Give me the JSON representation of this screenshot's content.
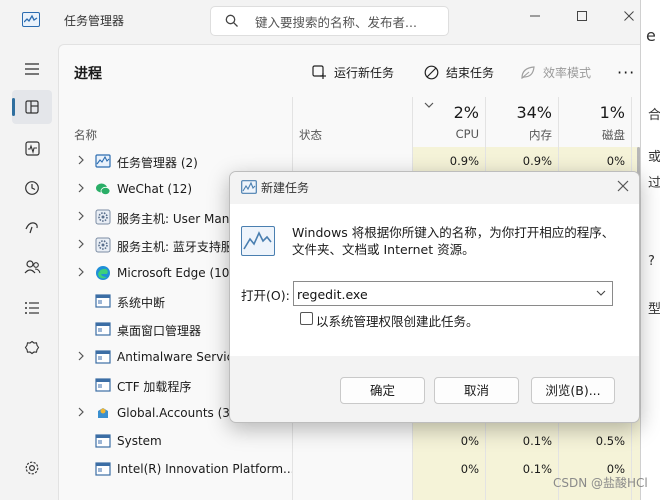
{
  "background_window": {
    "fragments": [
      "e",
      "合",
      "或",
      "过",
      "?",
      "型"
    ]
  },
  "window": {
    "title": "任务管理器",
    "search_placeholder": "键入要搜索的名称、发布者...",
    "controls": {
      "minimize_icon": "minimize-icon",
      "maximize_icon": "maximize-icon",
      "close_icon": "close-icon"
    }
  },
  "rail": {
    "items": [
      {
        "name": "menu-icon"
      },
      {
        "name": "processes-icon",
        "active": true
      },
      {
        "name": "performance-icon"
      },
      {
        "name": "app-history-icon"
      },
      {
        "name": "startup-apps-icon"
      },
      {
        "name": "users-icon"
      },
      {
        "name": "details-icon"
      },
      {
        "name": "services-icon"
      },
      {
        "name": "settings-icon"
      }
    ]
  },
  "page": {
    "title": "进程",
    "commands": {
      "new_task": "运行新任务",
      "end_task": "结束任务",
      "efficiency": "效率模式",
      "more": "···"
    }
  },
  "table": {
    "headers": {
      "name": "名称",
      "status": "状态",
      "cpu_pct": "2%",
      "cpu": "CPU",
      "mem_pct": "34%",
      "mem": "内存",
      "disk_pct": "1%",
      "disk": "磁盘"
    },
    "rows": [
      {
        "name": "任务管理器 (2)",
        "expand": true,
        "icon": "task-manager-icon",
        "cpu": "0.9%",
        "mem": "0.9%",
        "disk": "0%"
      },
      {
        "name": "WeChat (12)",
        "expand": true,
        "icon": "wechat-icon",
        "cpu": "",
        "mem": "",
        "disk": ""
      },
      {
        "name": "服务主机: User Manager",
        "expand": true,
        "icon": "service-host-icon",
        "cpu": "",
        "mem": "",
        "disk": ""
      },
      {
        "name": "服务主机: 蓝牙支持服务",
        "expand": true,
        "icon": "service-host-icon",
        "cpu": "",
        "mem": "",
        "disk": ""
      },
      {
        "name": "Microsoft Edge (10)",
        "expand": true,
        "icon": "edge-icon",
        "cpu": "",
        "mem": "",
        "disk": ""
      },
      {
        "name": "系统中断",
        "expand": false,
        "icon": "process-icon",
        "cpu": "",
        "mem": "",
        "disk": ""
      },
      {
        "name": "桌面窗口管理器",
        "expand": false,
        "icon": "process-icon",
        "cpu": "",
        "mem": "",
        "disk": ""
      },
      {
        "name": "Antimalware Service",
        "expand": true,
        "icon": "process-icon",
        "cpu": "",
        "mem": "",
        "disk": ""
      },
      {
        "name": "CTF 加载程序",
        "expand": false,
        "icon": "process-icon",
        "cpu": "",
        "mem": "",
        "disk": ""
      },
      {
        "name": "Global.Accounts (3)",
        "expand": true,
        "icon": "accounts-icon",
        "cpu": "",
        "mem": "",
        "disk": ""
      },
      {
        "name": "System",
        "expand": false,
        "icon": "process-icon",
        "cpu": "0%",
        "mem": "0.1%",
        "disk": "0.5%"
      },
      {
        "name": "Intel(R) Innovation Platform...",
        "expand": false,
        "icon": "process-icon",
        "cpu": "0%",
        "mem": "0.1%",
        "disk": "0%"
      }
    ]
  },
  "dialog": {
    "title": "新建任务",
    "description": "Windows 将根据你所键入的名称，为你打开相应的程序、文件夹、文档或 Internet 资源。",
    "open_label": "打开(O):",
    "open_value": "regedit.exe",
    "admin_label": "以系统管理权限创建此任务。",
    "admin_checked": false,
    "ok": "确定",
    "cancel": "取消",
    "browse": "浏览(B)..."
  },
  "watermark": "CSDN @盐酸HCl",
  "colors": {
    "accent": "#2f6f9f",
    "heat": "#f5f3d8",
    "dialog_bg": "#f3f3f3"
  }
}
